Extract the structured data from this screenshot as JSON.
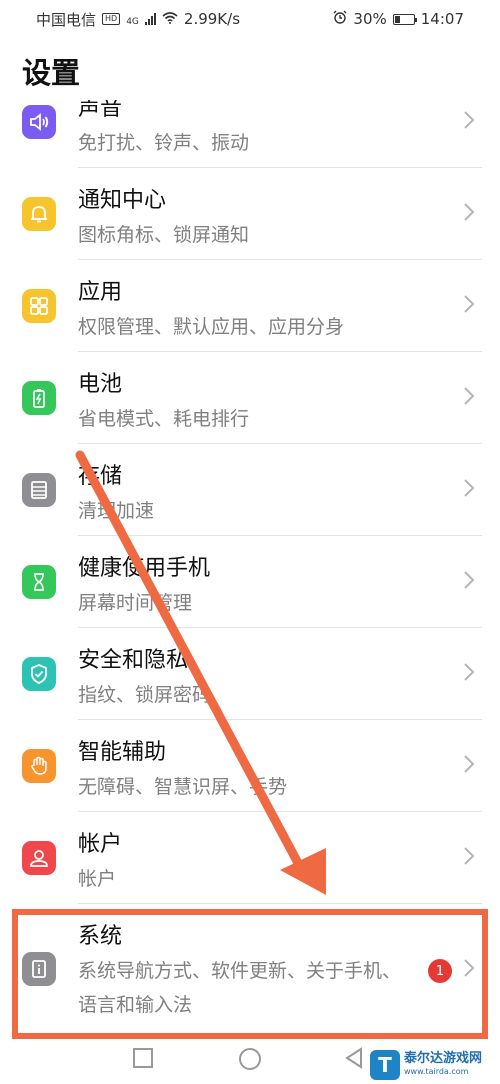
{
  "status_bar": {
    "carrier": "中国电信",
    "hd": "HD",
    "network": "4G",
    "speed": "2.99K/s",
    "battery_percent": "30%",
    "time": "14:07",
    "battery_level": 0.3
  },
  "page_title": "设置",
  "items": [
    {
      "title": "声音",
      "subtitle": "免打扰、铃声、振动",
      "icon": "speaker-icon",
      "color": "#7b5cf0"
    },
    {
      "title": "通知中心",
      "subtitle": "图标角标、锁屏通知",
      "icon": "bell-icon",
      "color": "#f6c52e"
    },
    {
      "title": "应用",
      "subtitle": "权限管理、默认应用、应用分身",
      "icon": "apps-grid-icon",
      "color": "#f6c52e"
    },
    {
      "title": "电池",
      "subtitle": "省电模式、耗电排行",
      "icon": "battery-icon",
      "color": "#34c759"
    },
    {
      "title": "存储",
      "subtitle": "清理加速",
      "icon": "storage-icon",
      "color": "#8e8e93"
    },
    {
      "title": "健康使用手机",
      "subtitle": "屏幕时间管理",
      "icon": "hourglass-icon",
      "color": "#34c759"
    },
    {
      "title": "安全和隐私",
      "subtitle": "指纹、锁屏密码",
      "icon": "shield-check-icon",
      "color": "#2cc3b5"
    },
    {
      "title": "智能辅助",
      "subtitle": "无障碍、智慧识屏、手势",
      "icon": "hand-icon",
      "color": "#f7942e"
    },
    {
      "title": "帐户",
      "subtitle": "帐户",
      "icon": "account-icon",
      "color": "#f0474d"
    },
    {
      "title": "系统",
      "subtitle": "系统导航方式、软件更新、关于手机、语言和输入法",
      "icon": "info-icon",
      "color": "#8e8e93",
      "badge": "1"
    }
  ],
  "watermark": {
    "name": "泰尔达游戏网",
    "url": "www.tairda.com",
    "logo_letter": "T"
  },
  "colors": {
    "annotation": "#ef6a43",
    "badge": "#e53935"
  }
}
